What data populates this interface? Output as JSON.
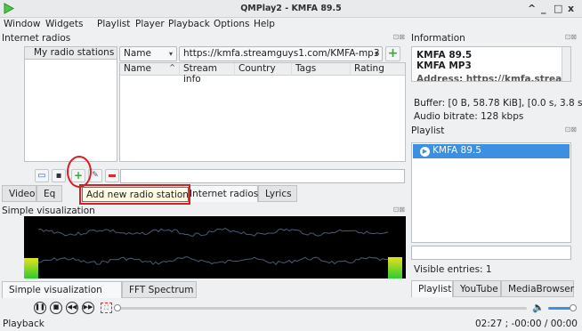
{
  "window": {
    "title": "QMPlay2 - KMFA 89.5",
    "controls": [
      "^",
      "_",
      "□",
      "x"
    ]
  },
  "menu": [
    "Window",
    "Widgets",
    "Playlist",
    "Player",
    "Playback",
    "Options",
    "Help"
  ],
  "internet_radios": {
    "panel_title": "Internet radios",
    "my_stations_label": "My radio stations",
    "search_type": "Name",
    "url_value": "https://kmfa.streamguys1.com/KMFA-mp3",
    "columns": [
      "Name",
      "Stream info",
      "Country",
      "Tags",
      "Rating"
    ],
    "sort_indicator": "^"
  },
  "tooltip": "Add new radio station",
  "center_tabs": [
    "Video",
    "Eq",
    "Internet radios",
    "Lyrics"
  ],
  "visualization": {
    "panel_title": "Simple visualization",
    "tabs": [
      "Simple visualization",
      "FFT Spectrum"
    ],
    "left_level_fraction": 0.33,
    "right_level_fraction": 0.35
  },
  "information": {
    "panel_title": "Information",
    "station_name": "KMFA 89.5",
    "format": "KMFA MP3",
    "address_partial": "Address: https://kmfa.streamgu...",
    "buffer": "Buffer: [0 B, 58.78 KiB], [0.0 s, 3.8 s]",
    "bitrate": "Audio bitrate: 128 kbps"
  },
  "playlist": {
    "panel_title": "Playlist",
    "items": [
      "KMFA 89.5"
    ],
    "visible_entries": "Visible entries: 1",
    "tabs": [
      "Playlist",
      "YouTube",
      "MediaBrowser"
    ]
  },
  "status": {
    "text": "Playback",
    "time": "02:27 ; -00:00 / 00:00"
  },
  "colors": {
    "accent": "#3d8fe0",
    "tooltip_highlight": "#e02020",
    "annotation_circle": "#d81e1e",
    "vu_green": "#2dcc2d",
    "vu_yellow": "#e6e020"
  }
}
